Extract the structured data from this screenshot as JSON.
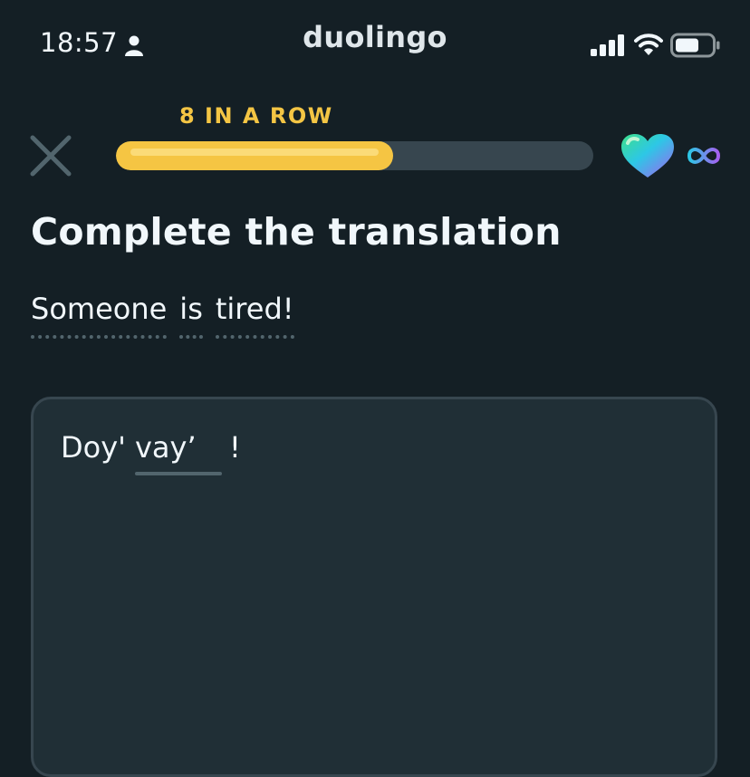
{
  "status_bar": {
    "time": "18:57",
    "app_name": "duolingo",
    "icons": [
      "person-icon",
      "cellular-signal-icon",
      "wifi-icon",
      "battery-icon"
    ]
  },
  "header": {
    "streak_label": "8 IN A ROW",
    "progress": 0.58,
    "hearts": "∞",
    "icons": [
      "close-icon",
      "heart-icon",
      "infinity-icon"
    ],
    "colors": {
      "progress": "#f5c543",
      "streak": "#f4c544",
      "track": "#37464f"
    }
  },
  "exercise": {
    "title": "Complete the translation",
    "prompt_words": [
      "Someone",
      "is",
      "tired!"
    ],
    "answer_prefix": "Doy'",
    "answer_input_value": "vay’",
    "answer_suffix": "!"
  },
  "colors": {
    "background": "#141f25",
    "panel": "#202f36",
    "border": "#37464f"
  }
}
